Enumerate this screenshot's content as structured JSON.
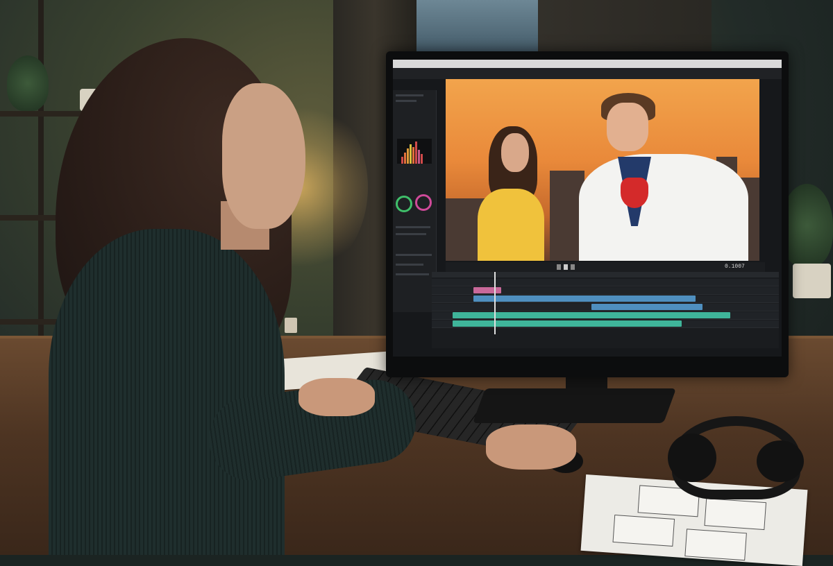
{
  "scene": {
    "description_tags": [
      "room",
      "desk",
      "monitor",
      "video-editor",
      "person",
      "headphones",
      "keyboard",
      "storyboard"
    ]
  },
  "editor": {
    "timecode": "0.1007",
    "colors": {
      "sky_top": "#f2a44c",
      "sky_bottom": "#c66a2c",
      "clip_blue": "#4f8fbf",
      "clip_teal": "#3fb59a",
      "clip_pink": "#c9699a",
      "scope_green": "#3fbf6a",
      "scope_pink": "#d04a9a",
      "scope_yellow": "#d8c040"
    },
    "playhead_fraction": 0.18
  }
}
